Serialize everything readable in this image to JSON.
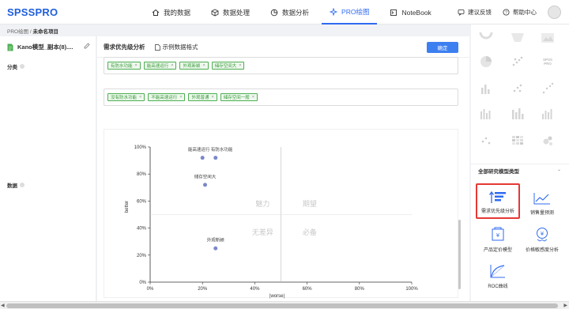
{
  "app": {
    "logo": "SPSSPRO"
  },
  "nav": [
    {
      "label": "我的数据",
      "icon": "home-icon"
    },
    {
      "label": "数据处理",
      "icon": "cube-icon"
    },
    {
      "label": "数据分析",
      "icon": "pie-icon"
    },
    {
      "label": "PRO绘图",
      "icon": "pro-chart-icon",
      "active": true
    },
    {
      "label": "NoteBook",
      "icon": "notebook-icon"
    }
  ],
  "tools": {
    "feedback": "建议反馈",
    "help": "帮助中心"
  },
  "breadcrumb": {
    "root": "PRO绘图",
    "sep": " / ",
    "current": "未命名项目"
  },
  "left": {
    "file_name": "Kano模型_副本(8)....",
    "category_label": "分类",
    "data_label": "数据"
  },
  "center": {
    "tab_active": "需求优先级分析",
    "tab_example": "示例数据格式",
    "confirm": "确定",
    "tags_row1": [
      "有防水功能",
      "能高速运行",
      "外观新颖",
      "储存空间大"
    ],
    "tags_row2": [
      "没有防水功能",
      "不能高速运行",
      "外观普通",
      "储存空间一般"
    ]
  },
  "chart_data": {
    "type": "scatter",
    "xlabel": "|worse|",
    "ylabel": "better",
    "xlim": [
      0,
      100
    ],
    "ylim": [
      0,
      100
    ],
    "x_ticks": [
      "0%",
      "20%",
      "40%",
      "60%",
      "80%",
      "100%"
    ],
    "y_ticks": [
      "0%",
      "20%",
      "40%",
      "60%",
      "80%",
      "100%"
    ],
    "points": [
      {
        "x": 20,
        "y": 92,
        "label": "能高速运行"
      },
      {
        "x": 25,
        "y": 92,
        "label": "有防水功能"
      },
      {
        "x": 21,
        "y": 72,
        "label": "储存空间大"
      },
      {
        "x": 25,
        "y": 25,
        "label": "外观新颖"
      }
    ],
    "point_labels": [
      {
        "text": "能高速运行 有防水功能",
        "x": 23,
        "y": 97
      },
      {
        "text": "储存空间大",
        "x": 21,
        "y": 77
      },
      {
        "text": "外观新颖",
        "x": 25,
        "y": 30
      }
    ],
    "quadrant_labels": {
      "top_left": "魅力",
      "top_right": "期望",
      "bottom_left": "无差异",
      "bottom_right": "必备"
    },
    "divider_x": 50,
    "divider_y": 50,
    "grid": false,
    "point_color": "#7b88c9"
  },
  "right": {
    "section_title": "全部研究模型类型",
    "models": [
      {
        "label": "需求优先级分析",
        "icon": "priority-bars-icon",
        "selected": true
      },
      {
        "label": "销售量预测",
        "icon": "trend-line-icon"
      },
      {
        "label": "产品定价模型",
        "icon": "price-tag-icon"
      },
      {
        "label": "价格敏感度分析",
        "icon": "price-sensitivity-icon"
      },
      {
        "label": "ROC曲线",
        "icon": "roc-curve-icon"
      }
    ]
  },
  "colors": {
    "accent": "#2f6bf0",
    "tag_green": "#4caf50",
    "selected_red": "#e53935"
  }
}
